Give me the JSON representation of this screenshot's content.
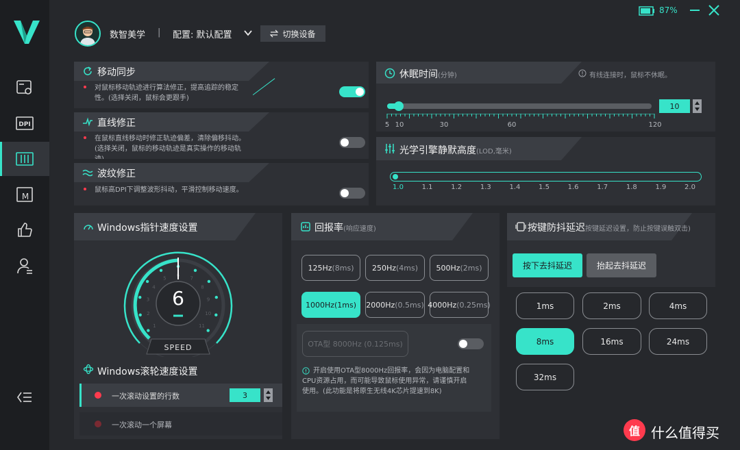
{
  "topbar": {
    "user_name": "数智美学",
    "sep": "|",
    "config_label": "配置: 默认配置",
    "switch_label": "切换设备",
    "battery": "87%"
  },
  "sidebar": {
    "items": [
      "graphics-card",
      "dpi",
      "equalizer",
      "macro",
      "thumbs-up",
      "user"
    ],
    "dpi_text": "DPI",
    "macro_text": "M"
  },
  "motion_sync": {
    "title": "移动同步",
    "desc1": "对鼠标移动轨迹进行算法修正，提高追踪的稳定",
    "desc2": "性。(选择关闭，鼠标会更跟手)",
    "enabled": true
  },
  "line_correct": {
    "title": "直线修正",
    "desc1": "在鼠标直线移动时修正轨迹偏差，清除偏移抖动。",
    "desc2": "(选择关闭，鼠标的移动轨迹是真实操作的移动轨",
    "desc3": "迹)",
    "enabled": false
  },
  "ripple_correct": {
    "title": "波纹修正",
    "desc1": "鼠标高DPI下调整波形抖动，平滑控制移动速度。",
    "enabled": false
  },
  "sleep": {
    "title": "休眠时间",
    "unit": "(分钟)",
    "note": "有线连接时，鼠标不休眠。",
    "value": "10",
    "ticks": [
      "5",
      "10",
      "30",
      "60",
      "120"
    ]
  },
  "lod": {
    "title": "光学引擎静默高度",
    "unit": "(LOD,毫米)",
    "ticks": [
      "1.0",
      "1.1",
      "1.2",
      "1.3",
      "1.4",
      "1.5",
      "1.6",
      "1.7",
      "1.8",
      "1.9",
      "2.0"
    ],
    "selected": "1.0"
  },
  "pointer": {
    "title": "Windows指针速度设置",
    "value": "6",
    "label": "SPEED",
    "dial_numbers": [
      "1",
      "2",
      "3",
      "4",
      "5",
      "6",
      "7",
      "8",
      "9",
      "10",
      "11"
    ]
  },
  "wheel": {
    "title": "Windows滚轮速度设置",
    "lines_label": "一次滚动设置的行数",
    "lines_value": "3",
    "screen_label": "一次滚动一个屏幕"
  },
  "polling": {
    "title": "回报率",
    "unit": "(响应速度)",
    "options": [
      {
        "main": "125Hz",
        "sub": "(8ms)"
      },
      {
        "main": "250Hz",
        "sub": "(4ms)"
      },
      {
        "main": "500Hz",
        "sub": "(2ms)"
      },
      {
        "main": "1000Hz",
        "sub": "(1ms)"
      },
      {
        "main": "2000Hz",
        "sub": "(0.5ms)"
      },
      {
        "main": "4000Hz",
        "sub": "(0.25ms)"
      }
    ],
    "selected": "1000Hz",
    "ota_label": "OTA型 8000Hz (0.125ms)",
    "note1": "开启使用OTA型8000Hz回报率，会因为电脑配置和",
    "note2": "CPU资源占用，而可能导致鼠标使用异常，请谨慎开启",
    "note3": "使用。(此功能是将原生无线4K芯片提速到8K)"
  },
  "debounce": {
    "title": "按键防抖延迟",
    "unit": "按键延迟设置，防止按键误触双击)",
    "tab_press": "按下去抖延迟",
    "tab_release": "抬起去抖延迟",
    "options": [
      "1ms",
      "2ms",
      "4ms",
      "8ms",
      "16ms",
      "24ms",
      "32ms"
    ],
    "selected": "8ms"
  },
  "watermark": {
    "icon_text": "值",
    "text": "什么值得买"
  },
  "colors": {
    "accent": "#37e3c9",
    "bg": "#26282c",
    "panel": "#2e3035",
    "warn_dot": "#ff3b4e"
  }
}
